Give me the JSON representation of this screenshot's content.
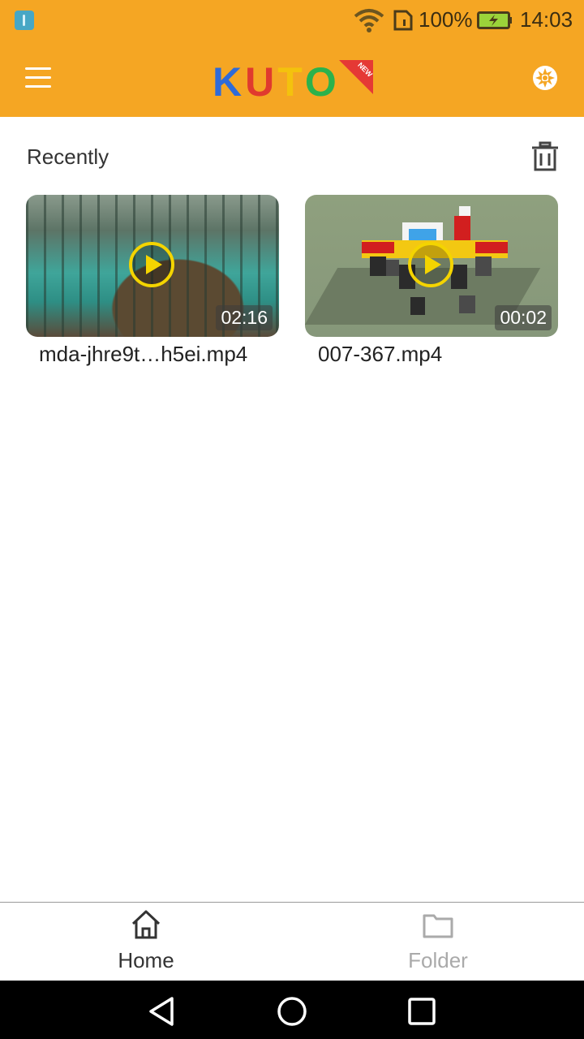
{
  "status_bar": {
    "battery_percent": "100%",
    "time": "14:03",
    "icons": [
      "usb-icon",
      "wifi-icon",
      "sim-icon",
      "battery-charging-icon"
    ]
  },
  "app_bar": {
    "logo_text": "KUTO",
    "logo_badge": "NEW",
    "left_icon": "menu-icon",
    "right_icon": "settings-icon"
  },
  "recent": {
    "title": "Recently",
    "action_icon": "trash-icon",
    "videos": [
      {
        "name": "mda-jhre9t…h5ei.mp4",
        "duration": "02:16"
      },
      {
        "name": "007-367.mp4",
        "duration": "00:02"
      }
    ]
  },
  "bottom_nav": {
    "items": [
      {
        "label": "Home",
        "icon": "home-icon",
        "active": true
      },
      {
        "label": "Folder",
        "icon": "folder-icon",
        "active": false
      }
    ]
  },
  "colors": {
    "accent": "#f5a623",
    "active_nav": "#333333",
    "inactive_nav": "#aaaaaa"
  }
}
